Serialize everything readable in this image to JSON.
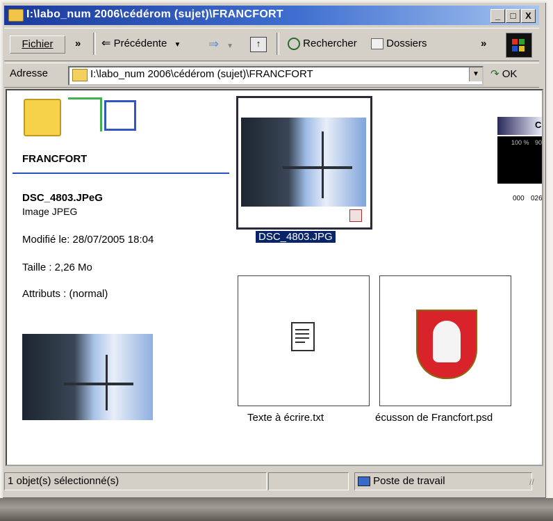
{
  "window": {
    "title": "I:\\labo_num 2006\\cédérom (sujet)\\FRANCFORT",
    "buttons": {
      "minimize": "_",
      "maximize": "□",
      "close": "X"
    }
  },
  "toolbar": {
    "menu_fichier": "Fichier",
    "chevron1": "»",
    "back": "Précédente",
    "search": "Rechercher",
    "folders": "Dossiers",
    "chevron2": "»"
  },
  "address": {
    "label": "Adresse",
    "value": "I:\\labo_num 2006\\cédérom (sujet)\\FRANCFORT",
    "go": "OK"
  },
  "leftpane": {
    "folder_name": "FRANCFORT",
    "file_name": "DSC_4803.JPeG",
    "file_type": "Image JPEG",
    "modified": "Modifié le: 28/07/2005 18:04",
    "size": "Taille : 2,26 Mo",
    "attributes": "Attributs : (normal)"
  },
  "files": [
    {
      "name": "DSC_4803.JPG",
      "selected": true
    },
    {
      "name": "Texte à écrire.txt",
      "selected": false
    },
    {
      "name": "écusson de Francfort.psd",
      "selected": false
    }
  ],
  "overlay_widget": {
    "title": "Ch",
    "pct1": "100 %",
    "pct2": "90",
    "v1": "000",
    "v2": "026"
  },
  "status": {
    "selection": "1 objet(s) sélectionné(s)",
    "location": "Poste de travail"
  },
  "colors": {
    "title_gradient_start": "#1a3a9c",
    "selection": "#0a246a",
    "separator_line": "#2a52be"
  }
}
